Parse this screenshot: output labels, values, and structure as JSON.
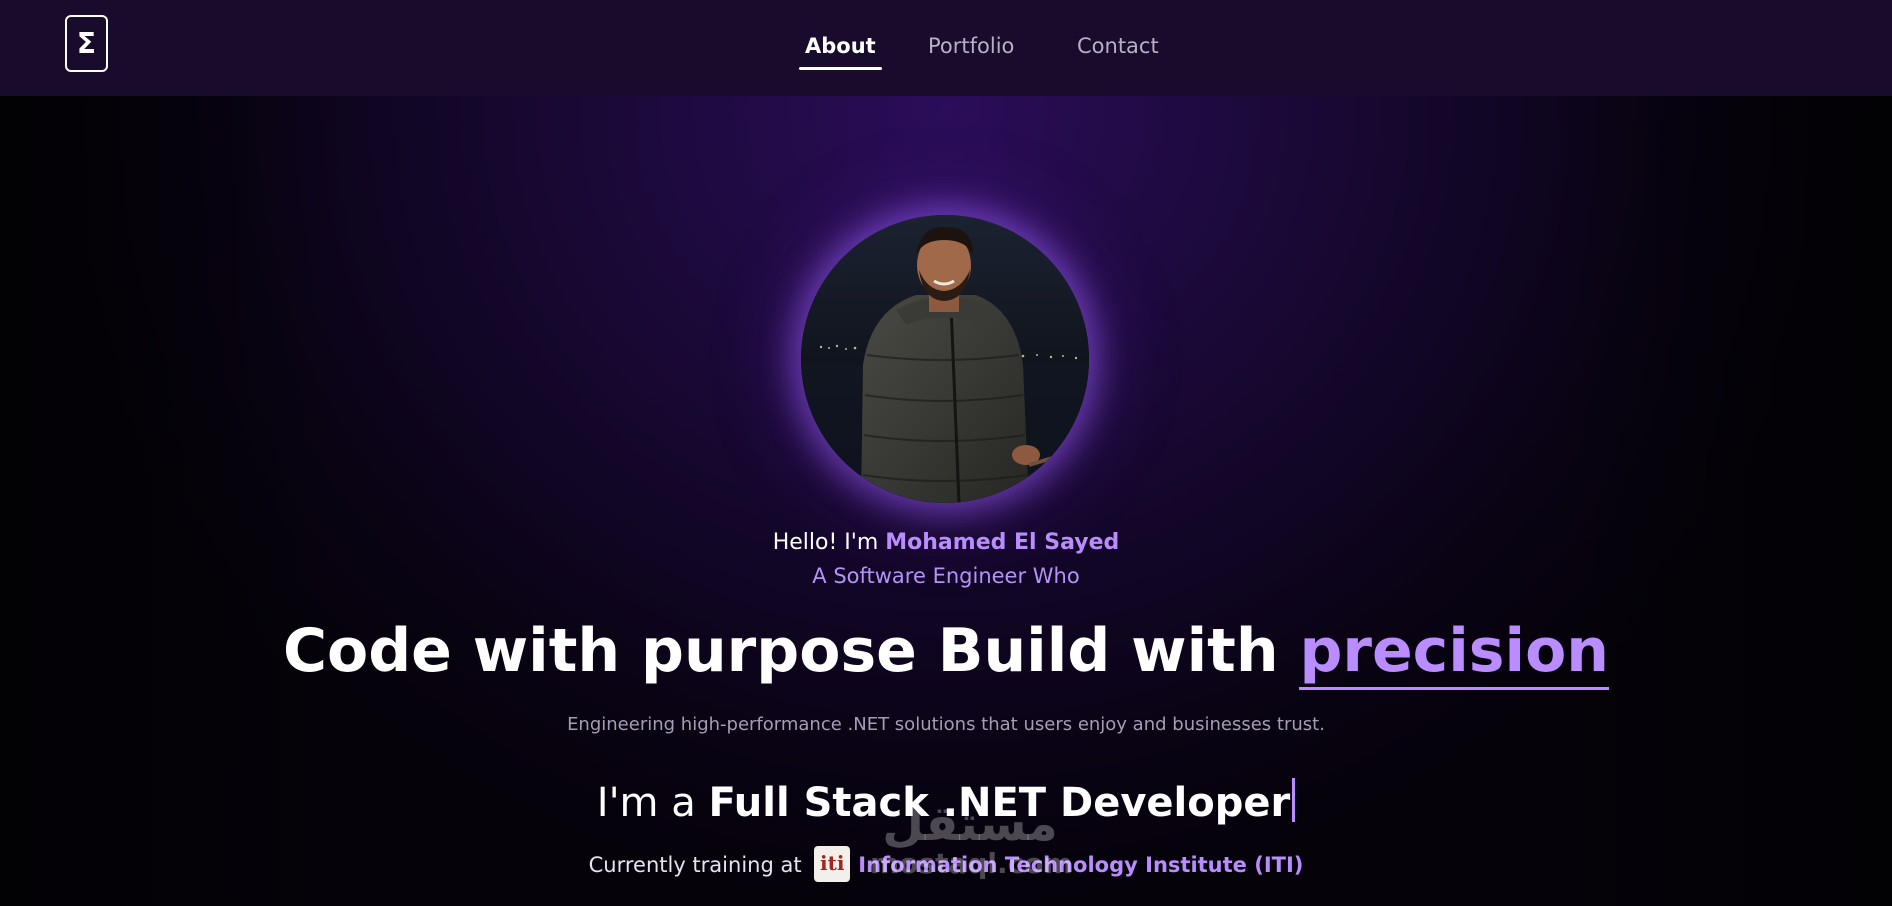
{
  "nav": {
    "logo": "Σ",
    "links": [
      "About",
      "Portfolio",
      "Contact"
    ],
    "active": "About"
  },
  "hero": {
    "greeting": "Hello! I'm ",
    "name": "Mohamed El Sayed",
    "tagline": "A Software Engineer Who",
    "headline_main": "Code with purpose Build with ",
    "headline_accent": "precision",
    "subheadline": "Engineering high-performance .NET solutions that users enjoy and businesses trust.",
    "role_prefix": "I'm a ",
    "role": "Full Stack .NET Developer",
    "training_prefix": "Currently training at",
    "training_org": "Information Technology Institute (ITI)"
  },
  "watermark": {
    "arabic": "مستقل",
    "latin": "mostaql.com"
  },
  "colors": {
    "accent": "#b98cff",
    "navbar": "#190b2c",
    "background": "#07030f"
  }
}
